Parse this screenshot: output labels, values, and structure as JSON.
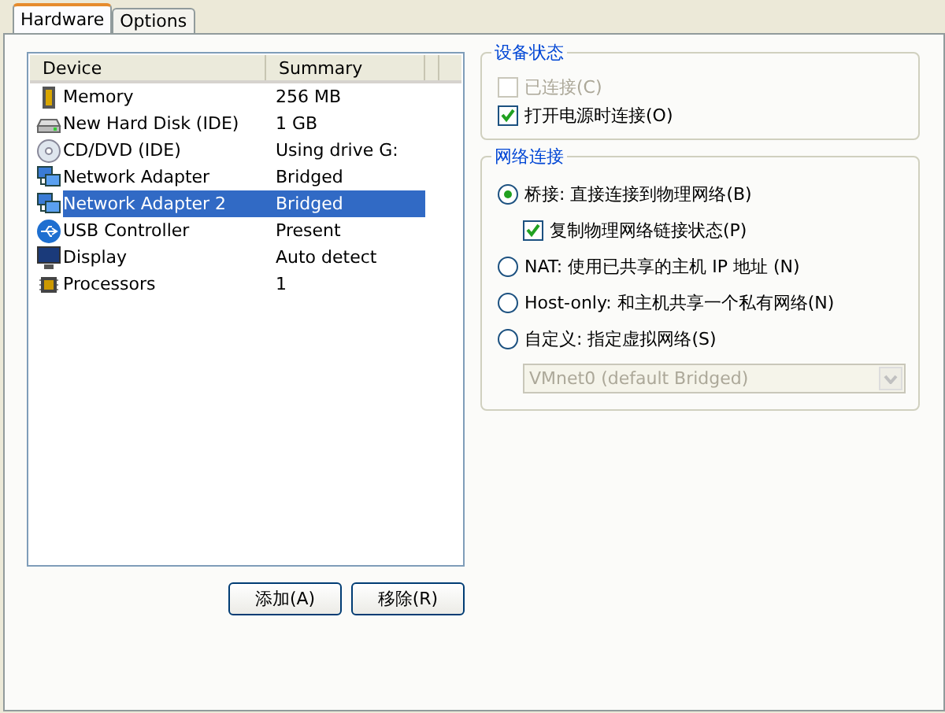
{
  "tabs": [
    {
      "label": "Hardware",
      "selected": true
    },
    {
      "label": "Options",
      "selected": false
    }
  ],
  "device_list": {
    "columns": [
      "Device",
      "Summary"
    ],
    "rows": [
      {
        "kind": "memory",
        "device": "Memory",
        "summary": "256 MB",
        "selected": false
      },
      {
        "kind": "disk",
        "device": "New Hard Disk (IDE)",
        "summary": "1 GB",
        "selected": false
      },
      {
        "kind": "cd",
        "device": "CD/DVD (IDE)",
        "summary": "Using drive G:",
        "selected": false
      },
      {
        "kind": "network",
        "device": "Network Adapter",
        "summary": "Bridged",
        "selected": false
      },
      {
        "kind": "network",
        "device": "Network Adapter 2",
        "summary": "Bridged",
        "selected": true
      },
      {
        "kind": "usb",
        "device": "USB Controller",
        "summary": "Present",
        "selected": false
      },
      {
        "kind": "display",
        "device": "Display",
        "summary": "Auto detect",
        "selected": false
      },
      {
        "kind": "cpu",
        "device": "Processors",
        "summary": "1",
        "selected": false
      }
    ]
  },
  "buttons": [
    "添加(A)",
    "移除(R)"
  ],
  "device_status": {
    "title": "设备状态",
    "options": [
      {
        "label": "已连接(C)",
        "checked": false,
        "disabled": true
      },
      {
        "label": "打开电源时连接(O)",
        "checked": true,
        "disabled": false
      }
    ]
  },
  "network_connection": {
    "title": "网络连接",
    "options": [
      {
        "kind": "radio",
        "label": "桥接: 直接连接到物理网络(B)",
        "selected": true
      },
      {
        "kind": "checkbox",
        "label": "复制物理网络链接状态(P)",
        "checked": true
      },
      {
        "kind": "radio",
        "label": "NAT: 使用已共享的主机 IP 地址 (N)",
        "selected": false
      },
      {
        "kind": "radio",
        "label": "Host-only: 和主机共享一个私有网络(N)",
        "selected": false
      },
      {
        "kind": "radio",
        "label": "自定义: 指定虚拟网络(S)",
        "selected": false
      }
    ],
    "network_select": {
      "value": "VMnet0 (default Bridged)",
      "disabled": true
    }
  }
}
